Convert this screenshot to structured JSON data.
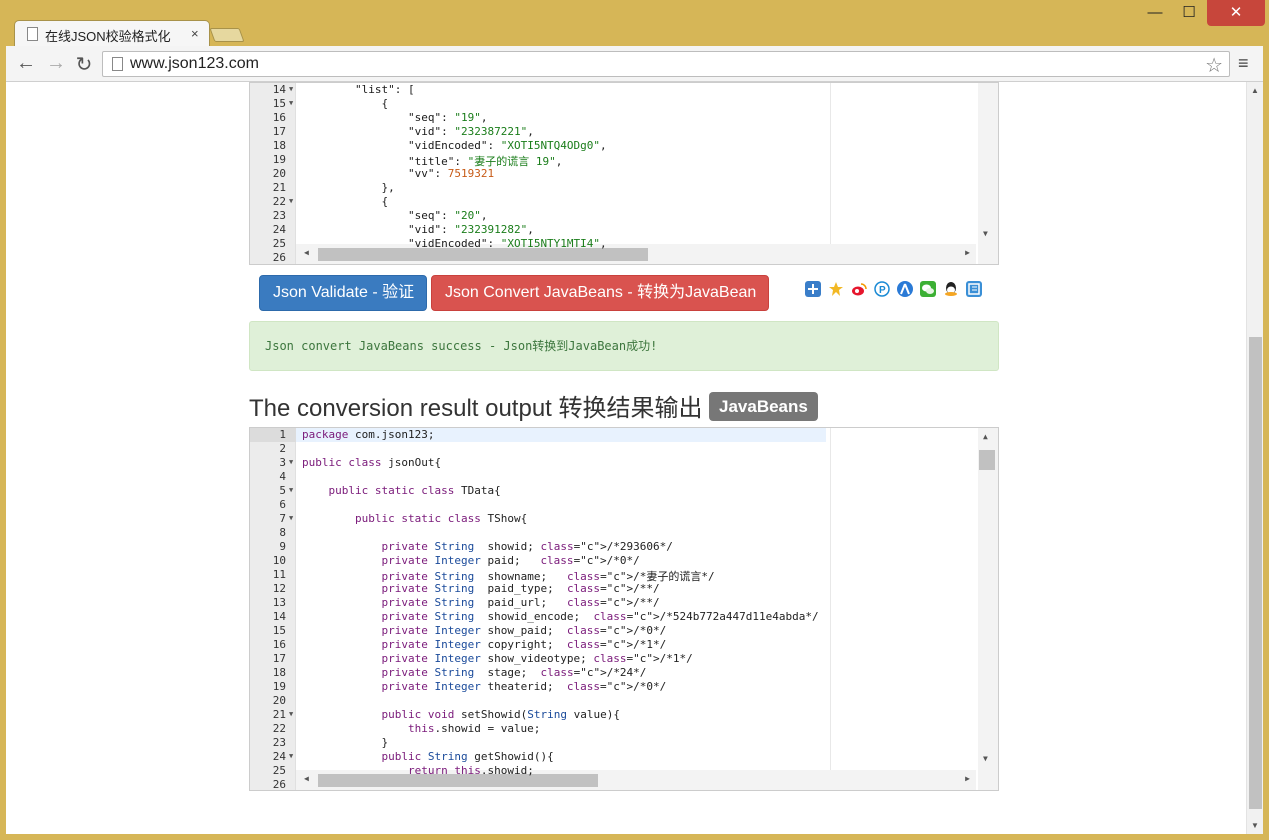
{
  "browser": {
    "tab_title": "在线JSON校验格式化",
    "url": "www.json123.com",
    "buttons": {
      "minimize": "—",
      "maximize": "☐",
      "close": "✕"
    }
  },
  "input_editor": {
    "line_numbers": [
      "14",
      "15",
      "16",
      "17",
      "18",
      "19",
      "20",
      "21",
      "22",
      "23",
      "24",
      "25",
      "26"
    ],
    "lines": [
      "        \"list\": [",
      "            {",
      "                \"seq\": \"19\",",
      "                \"vid\": \"232387221\",",
      "                \"vidEncoded\": \"XOTI5NTQ4ODg0\",",
      "                \"title\": \"妻子的谎言 19\",",
      "                \"vv\": 7519321",
      "            },",
      "            {",
      "                \"seq\": \"20\",",
      "                \"vid\": \"232391282\",",
      "                \"vidEncoded\": \"XOTI5NTY1MTI4\",",
      ""
    ]
  },
  "actions": {
    "validate_label": "Json Validate - 验证",
    "convert_label": "Json Convert JavaBeans - 转换为JavaBean"
  },
  "share_icons": [
    "plus-share-icon",
    "qzone-icon",
    "weibo-icon",
    "pinterest-icon",
    "renren-icon",
    "wechat-icon",
    "qq-icon",
    "netease-icon"
  ],
  "colors": {
    "validate": "#3a7bc0",
    "convert": "#d9534f",
    "success_bg": "#dff0d8",
    "success_text": "#3c763d"
  },
  "alert": {
    "message": "Json convert JavaBeans success - Json转换到JavaBean成功!"
  },
  "output": {
    "heading": "The conversion result output 转换结果输出",
    "badge": "JavaBeans"
  },
  "output_editor": {
    "line_numbers": [
      "1",
      "2",
      "3",
      "4",
      "5",
      "6",
      "7",
      "8",
      "9",
      "10",
      "11",
      "12",
      "13",
      "14",
      "15",
      "16",
      "17",
      "18",
      "19",
      "20",
      "21",
      "22",
      "23",
      "24",
      "25",
      "26"
    ],
    "lines": [
      "package com.json123;",
      "",
      "public class jsonOut{",
      "",
      "    public static class TData{",
      "",
      "        public static class TShow{",
      "",
      "            private String  showid; /*293606*/",
      "            private Integer paid;   /*0*/",
      "            private String  showname;   /*妻子的谎言*/",
      "            private String  paid_type;  /**/",
      "            private String  paid_url;   /**/",
      "            private String  showid_encode;  /*524b772a447d11e4abda*/",
      "            private Integer show_paid;  /*0*/",
      "            private Integer copyright;  /*1*/",
      "            private Integer show_videotype; /*1*/",
      "            private String  stage;  /*24*/",
      "            private Integer theaterid;  /*0*/",
      "",
      "            public void setShowid(String value){",
      "                this.showid = value;",
      "            }",
      "            public String getShowid(){",
      "                return this.showid;",
      ""
    ]
  }
}
